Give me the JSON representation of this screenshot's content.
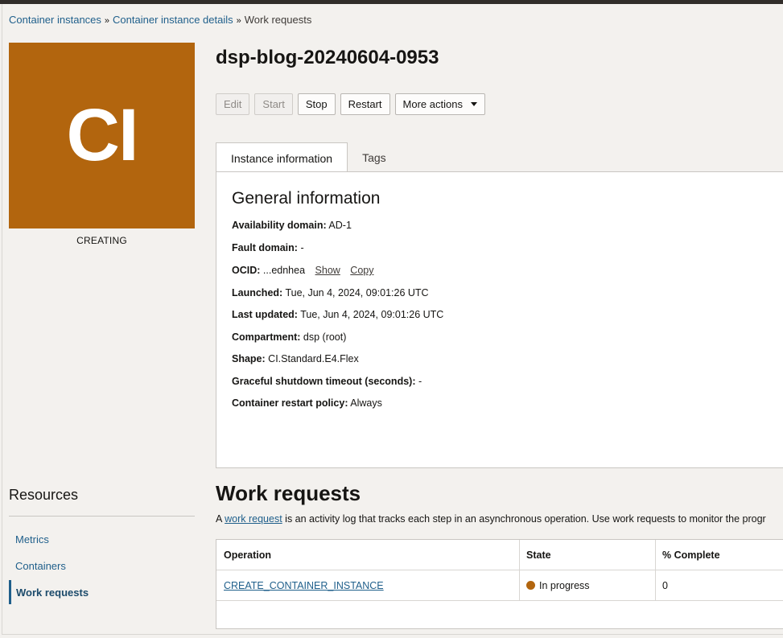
{
  "breadcrumb": {
    "items": [
      "Container instances",
      "Container instance details"
    ],
    "current": "Work requests",
    "separator": "»"
  },
  "instance": {
    "icon_text": "CI",
    "status": "CREATING",
    "title": "dsp-blog-20240604-0953"
  },
  "actions": {
    "edit": "Edit",
    "start": "Start",
    "stop": "Stop",
    "restart": "Restart",
    "more": "More actions"
  },
  "tabs": [
    "Instance information",
    "Tags"
  ],
  "general": {
    "heading": "General information",
    "availability_label": "Availability domain:",
    "availability_value": "AD-1",
    "fault_label": "Fault domain:",
    "fault_value": "-",
    "ocid_label": "OCID:",
    "ocid_value": "...ednhea",
    "ocid_show": "Show",
    "ocid_copy": "Copy",
    "launched_label": "Launched:",
    "launched_value": "Tue, Jun 4, 2024, 09:01:26 UTC",
    "updated_label": "Last updated:",
    "updated_value": "Tue, Jun 4, 2024, 09:01:26 UTC",
    "compartment_label": "Compartment:",
    "compartment_value": "dsp (root)",
    "shape_label": "Shape:",
    "shape_value": "CI.Standard.E4.Flex",
    "shutdown_label": "Graceful shutdown timeout (seconds):",
    "shutdown_value": "-",
    "restart_label": "Container restart policy:",
    "restart_value": "Always"
  },
  "resources": {
    "title": "Resources",
    "items": [
      "Metrics",
      "Containers",
      "Work requests"
    ]
  },
  "work_requests": {
    "title": "Work requests",
    "desc_prefix": "A ",
    "desc_link": "work request",
    "desc_suffix": " is an activity log that tracks each step in an asynchronous operation. Use work requests to monitor the progr",
    "columns": [
      "Operation",
      "State",
      "% Complete"
    ],
    "rows": [
      {
        "operation": "CREATE_CONTAINER_INSTANCE",
        "state": "In progress",
        "complete": "0"
      }
    ]
  },
  "colors": {
    "accent": "#b2650e",
    "link": "#1f5f8b"
  }
}
